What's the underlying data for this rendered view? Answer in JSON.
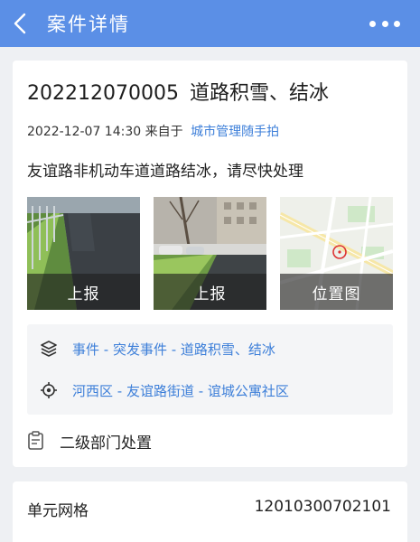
{
  "header": {
    "back_icon": "chevron-left-icon",
    "title": "案件详情",
    "more_icon": "more-dots-icon"
  },
  "case": {
    "id": "202212070005",
    "title": "道路积雪、结冰",
    "datetime": "2022-12-07 14:30",
    "source_prefix": "来自于",
    "source": "城市管理随手拍",
    "description": "友谊路非机动车道道路结冰，请尽快处理"
  },
  "photos": [
    {
      "label": "上报",
      "kind": "road-photo"
    },
    {
      "label": "上报",
      "kind": "street-photo"
    },
    {
      "label": "位置图",
      "kind": "map-thumbnail"
    }
  ],
  "info": {
    "category": "事件 - 突发事件 - 道路积雪、结冰",
    "category_icon": "layers-icon",
    "location": "河西区 - 友谊路街道 - 谊城公寓社区",
    "location_icon": "locate-target-icon"
  },
  "handling": {
    "icon": "clipboard-icon",
    "label": "二级部门处置"
  },
  "grid": {
    "label": "单元网格",
    "value": "12010300702101"
  },
  "colors": {
    "header_bg": "#5b8fe6",
    "link": "#3d7fd9",
    "page_bg": "#eef0f3"
  }
}
